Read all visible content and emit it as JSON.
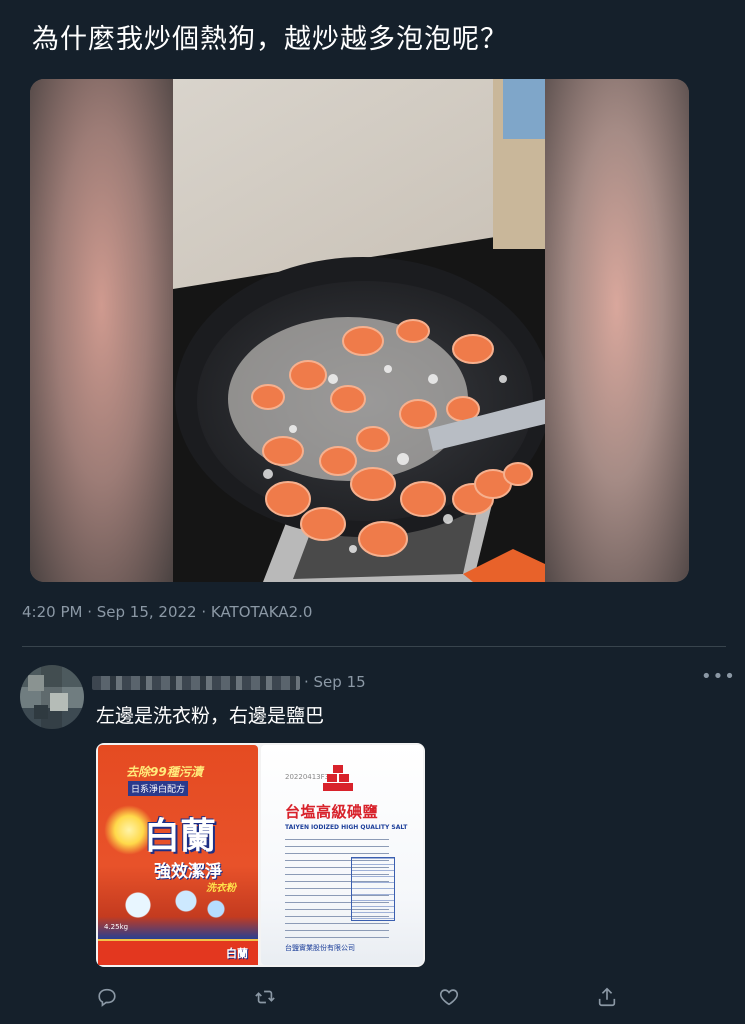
{
  "tweet": {
    "text": "為什麼我炒個熱狗，越炒越多泡泡呢？",
    "meta": "4:20 PM · Sep 15, 2022 · KATOTAKA2.0"
  },
  "reply": {
    "date": "· Sep 15",
    "more": "•••",
    "text": "左邊是洗衣粉，右邊是鹽巴",
    "image": {
      "left_pack": {
        "top_line": "去除99種污漬",
        "sub_line": "日系淨白配方",
        "brand": "白蘭",
        "slogan": "強效潔淨",
        "type": "洗衣粉",
        "weight": "4.25kg",
        "bottom_brand": "白蘭"
      },
      "right_pack": {
        "code": "20220413F3",
        "title": "台塩高級碘鹽",
        "subtitle": "TAIYEN IODIZED HIGH QUALITY SALT",
        "brand_line": "台鹽實業股份有限公司"
      }
    }
  },
  "icons": {
    "reply": "reply-icon",
    "retweet": "retweet-icon",
    "like": "heart-icon",
    "share": "share-icon"
  },
  "colors": {
    "background": "#15202b",
    "secondary_text": "#8b98a5",
    "divider": "#38444d"
  }
}
